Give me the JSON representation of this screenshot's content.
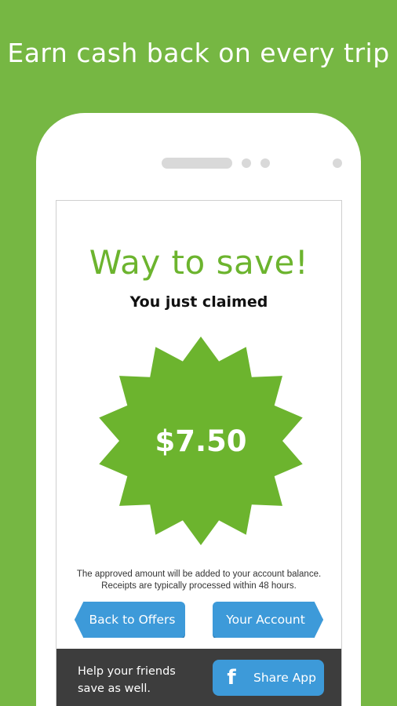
{
  "headline": "Earn cash back on every trip",
  "screen": {
    "title": "Way to save!",
    "subtitle": "You just claimed",
    "amount": "$7.50",
    "note_line1": "The approved amount will be added to your account balance.",
    "note_line2": "Receipts are typically processed within 48 hours.",
    "back_button": "Back to Offers",
    "account_button": "Your Account",
    "footer_line1": "Help your friends",
    "footer_line2": "save as well.",
    "share_button": "Share App",
    "share_icon": "facebook-icon"
  },
  "colors": {
    "background": "#76b743",
    "title": "#6cb42e",
    "burst": "#6cb42e",
    "button": "#3d9ad9",
    "footer": "#3d3d3d"
  }
}
